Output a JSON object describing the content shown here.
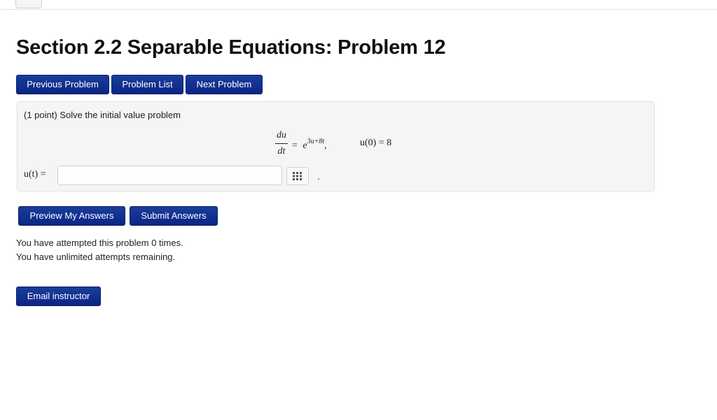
{
  "title": "Section 2.2 Separable Equations: Problem 12",
  "nav": {
    "previous": "Previous Problem",
    "list": "Problem List",
    "next": "Next Problem"
  },
  "problem": {
    "intro": "(1 point) Solve the initial value problem",
    "frac_num": "du",
    "frac_den": "dt",
    "equals": "=",
    "base": "e",
    "exponent": "3u+8t",
    "comma": ",",
    "initial_condition": "u(0) = 8",
    "answer_label": "u(t) =",
    "answer_value": "",
    "grid_icon": "equation-editor-grid-icon",
    "period": "."
  },
  "actions": {
    "preview": "Preview My Answers",
    "submit": "Submit Answers"
  },
  "status": {
    "attempts": "You have attempted this problem 0 times.",
    "remaining": "You have unlimited attempts remaining."
  },
  "email": "Email instructor",
  "colors": {
    "button": "#0b2585",
    "panel": "#f5f5f5"
  }
}
